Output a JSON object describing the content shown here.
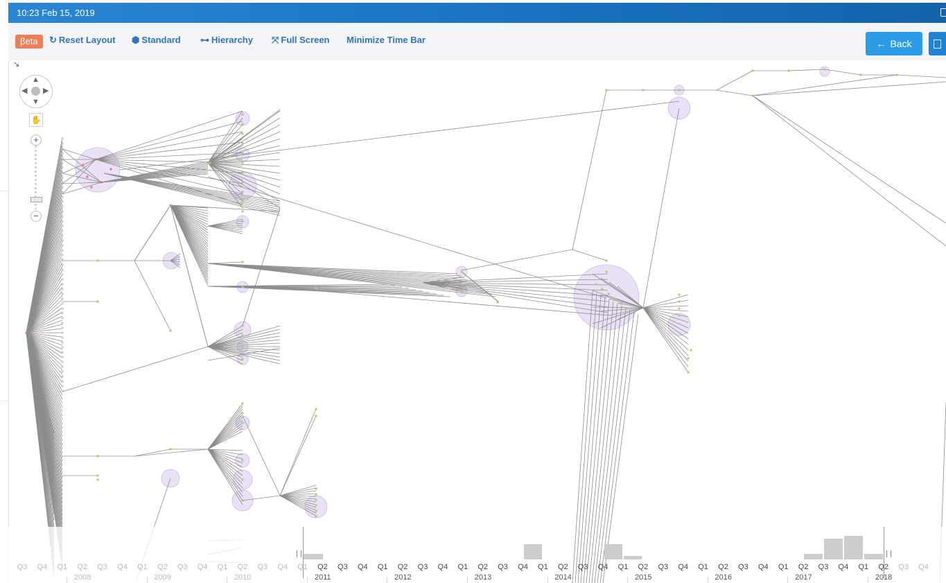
{
  "topbar": {
    "datetime": "10:23 Feb 15, 2019"
  },
  "toolbar": {
    "beta_label": "βeta",
    "reset_layout": "Reset Layout",
    "standard": "Standard",
    "hierarchy": "Hierarchy",
    "full_screen": "Full Screen",
    "minimize_time_bar": "Minimize Time Bar",
    "back": "Back"
  },
  "icons": {
    "reset": "refresh-icon",
    "standard": "cubes-icon",
    "hierarchy": "sitemap-icon",
    "full_screen": "expand-icon",
    "back": "arrow-left-icon",
    "save": "floppy-icon",
    "pan": "hand-icon"
  },
  "colors": {
    "topbar": "#1a72c0",
    "beta": "#ef7d57",
    "toolbar_text": "#2f73bf",
    "back_button": "#2d9ce8",
    "node_bubble": "#e8dcf5",
    "edge": "#8a8a8a",
    "timebar_bar": "#cccccc"
  },
  "timebar": {
    "quarters": [
      "Q3",
      "Q4",
      "Q1",
      "Q2",
      "Q3",
      "Q4",
      "Q1",
      "Q2",
      "Q3",
      "Q4",
      "Q1",
      "Q2",
      "Q3",
      "Q4",
      "Q1",
      "Q2",
      "Q3",
      "Q4",
      "Q1",
      "Q2",
      "Q3",
      "Q4",
      "Q1",
      "Q2",
      "Q3",
      "Q4",
      "Q1",
      "Q2",
      "Q3",
      "Q4",
      "Q1",
      "Q2",
      "Q3",
      "Q4",
      "Q1",
      "Q2",
      "Q3",
      "Q4",
      "Q1",
      "Q2",
      "Q3",
      "Q4",
      "Q1",
      "Q2",
      "Q3",
      "Q4"
    ],
    "years": [
      "2008",
      "2009",
      "2010",
      "2011",
      "2012",
      "2013",
      "2014",
      "2015",
      "2016",
      "2017",
      "2018"
    ]
  }
}
